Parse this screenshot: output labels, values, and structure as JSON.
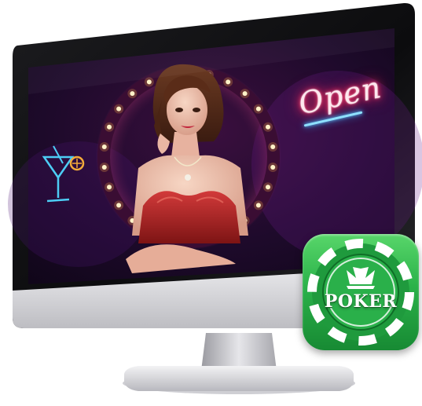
{
  "neon_sign": {
    "text": "Open",
    "color": "#ff2d5f"
  },
  "app_icon": {
    "label": "POKER",
    "icon": "crown-icon",
    "colors": {
      "primary": "#2bb24a",
      "light": "#58d66a",
      "dark": "#178a33"
    }
  },
  "scene": {
    "background": "#1a0826",
    "light_ring_color": "#ffb347",
    "cocktail_icon": "cocktail-glass-icon"
  }
}
